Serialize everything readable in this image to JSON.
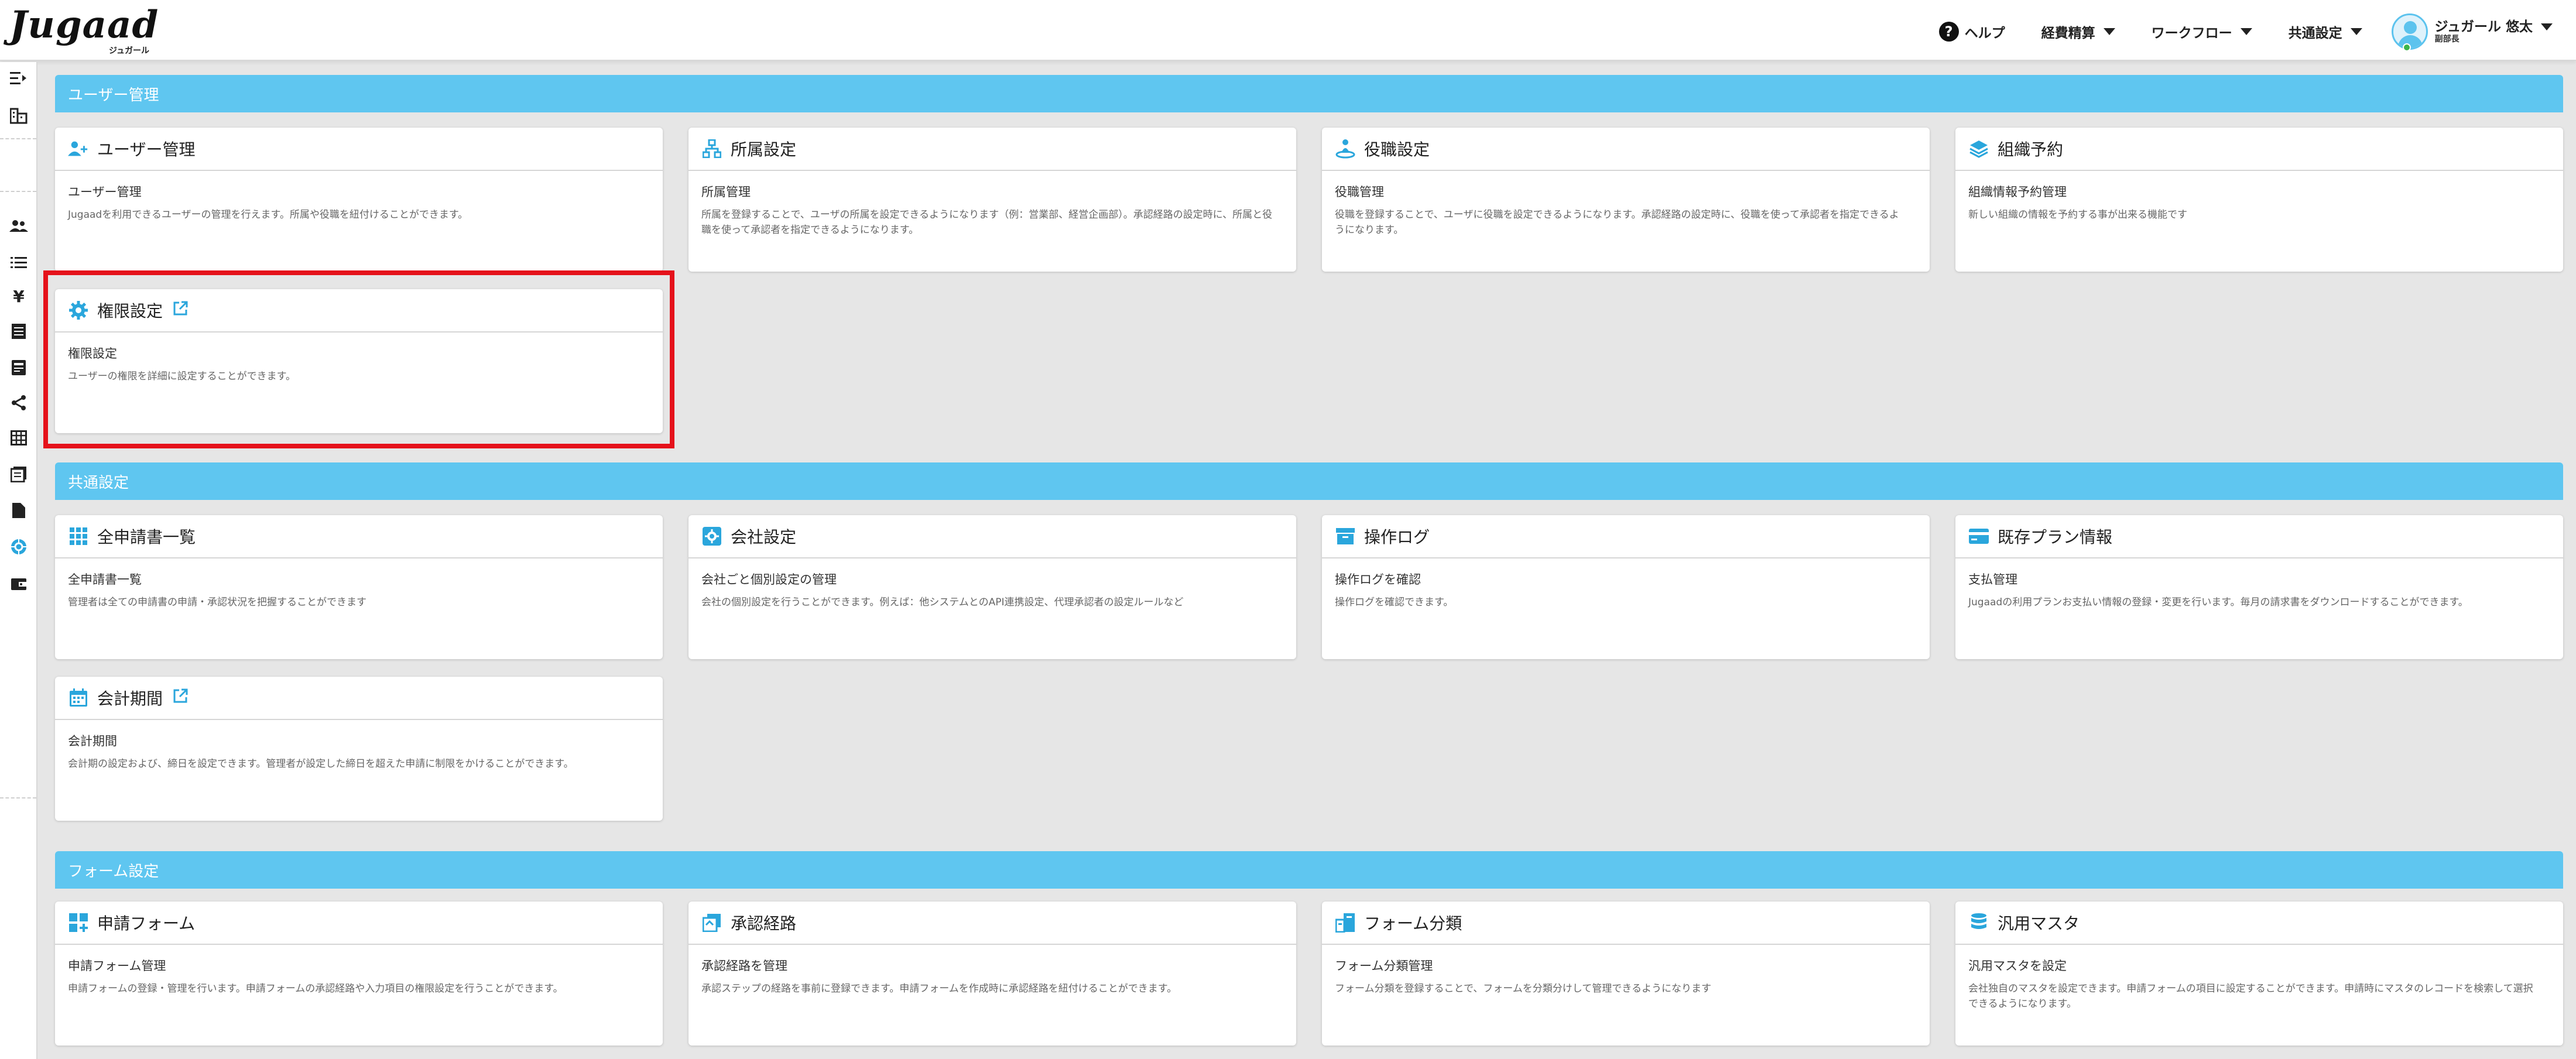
{
  "header": {
    "logo": "Jugaad",
    "logo_sub": "ジュガール",
    "nav": {
      "help": "ヘルプ",
      "expense": "経費精算",
      "workflow": "ワークフロー",
      "common": "共通設定"
    },
    "user": {
      "name": "ジュガール 悠太",
      "role": "副部長"
    }
  },
  "sections": {
    "user_mgmt": {
      "title": "ユーザー管理",
      "cards": [
        {
          "title": "ユーザー管理",
          "sub": "ユーザー管理",
          "desc": "Jugaadを利用できるユーザーの管理を行えます。所属や役職を紐付けることができます。"
        },
        {
          "title": "所属設定",
          "sub": "所属管理",
          "desc": "所属を登録することで、ユーザの所属を設定できるようになります（例：営業部、経営企画部）。承認経路の設定時に、所属と役職を使って承認者を指定できるようになります。"
        },
        {
          "title": "役職設定",
          "sub": "役職管理",
          "desc": "役職を登録することで、ユーザに役職を設定できるようになります。承認経路の設定時に、役職を使って承認者を指定できるようになります。"
        },
        {
          "title": "組織予約",
          "sub": "組織情報予約管理",
          "desc": "新しい組織の情報を予約する事が出来る機能です"
        },
        {
          "title": "権限設定",
          "sub": "権限設定",
          "desc": "ユーザーの権限を詳細に設定することができます。"
        }
      ]
    },
    "common": {
      "title": "共通設定",
      "cards": [
        {
          "title": "全申請書一覧",
          "sub": "全申請書一覧",
          "desc": "管理者は全ての申請書の申請・承認状況を把握することができます"
        },
        {
          "title": "会社設定",
          "sub": "会社ごと個別設定の管理",
          "desc": "会社の個別設定を行うことができます。例えば：他システムとのAPI連携設定、代理承認者の設定ルールなど"
        },
        {
          "title": "操作ログ",
          "sub": "操作ログを確認",
          "desc": "操作ログを確認できます。"
        },
        {
          "title": "既存プラン情報",
          "sub": "支払管理",
          "desc": "Jugaadの利用プランお支払い情報の登録・変更を行います。毎月の請求書をダウンロードすることができます。"
        },
        {
          "title": "会計期間",
          "sub": "会計期間",
          "desc": "会計期の設定および、締日を設定できます。管理者が設定した締日を超えた申請に制限をかけることができます。"
        }
      ]
    },
    "form": {
      "title": "フォーム設定",
      "cards": [
        {
          "title": "申請フォーム",
          "sub": "申請フォーム管理",
          "desc": "申請フォームの登録・管理を行います。申請フォームの承認経路や入力項目の権限設定を行うことができます。"
        },
        {
          "title": "承認経路",
          "sub": "承認経路を管理",
          "desc": "承認ステップの経路を事前に登録できます。申請フォームを作成時に承認経路を紐付けることができます。"
        },
        {
          "title": "フォーム分類",
          "sub": "フォーム分類管理",
          "desc": "フォーム分類を登録することで、フォームを分類分けして管理できるようになります"
        },
        {
          "title": "汎用マスタ",
          "sub": "汎用マスタを設定",
          "desc": "会社独自のマスタを設定できます。申請フォームの項目に設定することができます。申請時にマスタのレコードを検索して選択できるようになります。"
        }
      ]
    }
  },
  "colors": {
    "section_bar": "#5fc6f0",
    "accent": "#2aa6dc",
    "highlight": "#e5121b"
  }
}
